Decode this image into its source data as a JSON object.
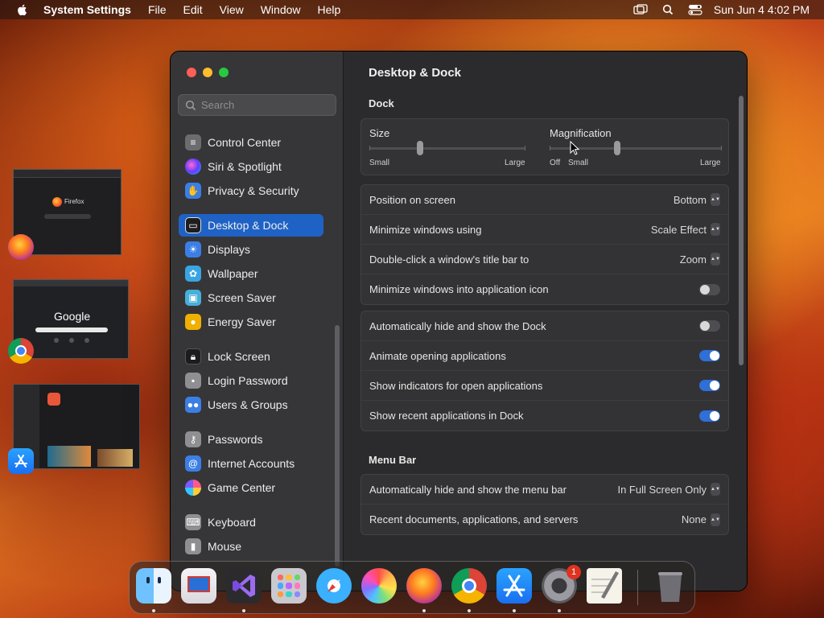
{
  "menubar": {
    "app_name": "System Settings",
    "menus": [
      "File",
      "Edit",
      "View",
      "Window",
      "Help"
    ],
    "clock": "Sun Jun 4  4:02 PM"
  },
  "search": {
    "placeholder": "Search"
  },
  "sidebar": {
    "items": [
      {
        "label": "Control Center",
        "icon": "control-center-icon",
        "color": "#6b6b70"
      },
      {
        "label": "Siri & Spotlight",
        "icon": "siri-icon",
        "color": "#8a3bd6"
      },
      {
        "label": "Privacy & Security",
        "icon": "hand-icon",
        "color": "#3b7fe5"
      },
      {
        "label": "Desktop & Dock",
        "icon": "dock-icon",
        "color": "#1e1e20"
      },
      {
        "label": "Displays",
        "icon": "sun-icon",
        "color": "#3b7fe5"
      },
      {
        "label": "Wallpaper",
        "icon": "flower-icon",
        "color": "#39a5e3"
      },
      {
        "label": "Screen Saver",
        "icon": "screen-saver-icon",
        "color": "#47b0d9"
      },
      {
        "label": "Energy Saver",
        "icon": "bulb-icon",
        "color": "#f0b000"
      },
      {
        "label": "Lock Screen",
        "icon": "lock-icon",
        "color": "#1c1c1e"
      },
      {
        "label": "Login Password",
        "icon": "login-lock-icon",
        "color": "#8e8e93"
      },
      {
        "label": "Users & Groups",
        "icon": "users-icon",
        "color": "#3b7fe5"
      },
      {
        "label": "Passwords",
        "icon": "key-icon",
        "color": "#8e8e93"
      },
      {
        "label": "Internet Accounts",
        "icon": "at-icon",
        "color": "#3b7fe5"
      },
      {
        "label": "Game Center",
        "icon": "game-center-icon",
        "color": "#e35a9b"
      },
      {
        "label": "Keyboard",
        "icon": "keyboard-icon",
        "color": "#8e8e93"
      },
      {
        "label": "Mouse",
        "icon": "mouse-icon",
        "color": "#8e8e93"
      }
    ]
  },
  "content": {
    "title": "Desktop & Dock",
    "dock_section": "Dock",
    "size": {
      "label": "Size",
      "min_label": "Small",
      "max_label": "Large",
      "level": 0.42
    },
    "magnification": {
      "label": "Magnification",
      "off_label": "Off",
      "min_label": "Small",
      "max_label": "Large",
      "level": 0.35
    },
    "rows_group1": [
      {
        "label": "Position on screen",
        "value": "Bottom"
      },
      {
        "label": "Minimize windows using",
        "value": "Scale Effect"
      },
      {
        "label": "Double-click a window's title bar to",
        "value": "Zoom"
      },
      {
        "label": "Minimize windows into application icon",
        "toggle": false
      }
    ],
    "rows_group2": [
      {
        "label": "Automatically hide and show the Dock",
        "toggle": false
      },
      {
        "label": "Animate opening applications",
        "toggle": true
      },
      {
        "label": "Show indicators for open applications",
        "toggle": true
      },
      {
        "label": "Show recent applications in Dock",
        "toggle": true
      }
    ],
    "menubar_section": "Menu Bar",
    "rows_group3": [
      {
        "label": "Automatically hide and show the menu bar",
        "value": "In Full Screen Only"
      },
      {
        "label": "Recent documents, applications, and servers",
        "value": "None"
      }
    ]
  },
  "desktop": {
    "firefox_thumb_text": "Firefox",
    "google_thumb_text": "Google"
  },
  "dock": {
    "apps": [
      "Finder",
      "Microsoft Remote Desktop",
      "Visual Studio",
      "Launchpad",
      "Safari",
      "Color",
      "Firefox",
      "Chrome",
      "App Store",
      "System Settings",
      "TextEdit",
      "Trash"
    ],
    "settings_badge": "1"
  }
}
